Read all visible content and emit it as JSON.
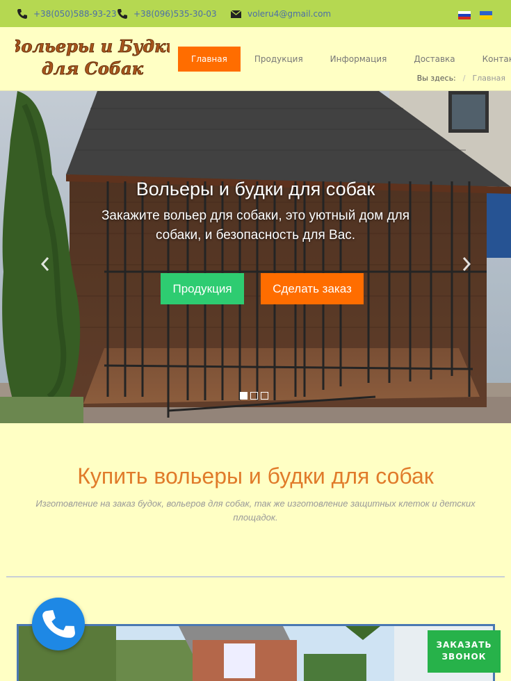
{
  "topbar": {
    "phone1": "+38(050)588-93-23",
    "phone2": "+38(096)535-30-03",
    "email": "voleru4@gmail.com",
    "phone_icon": "phone-icon",
    "email_icon": "envelope-icon",
    "flags": [
      "flag-ru-icon",
      "flag-ua-icon"
    ],
    "bg_color": "#b5d851"
  },
  "header": {
    "logo_lines": [
      "Вольеры и Будки",
      "для Собак"
    ],
    "nav": [
      "Главная",
      "Продукция",
      "Информация",
      "Доставка",
      "Контакты"
    ],
    "active_nav": "Главная",
    "breadcrumb": {
      "prefix": "Вы здесь:",
      "separator": "/",
      "current": "Главная"
    },
    "accent_color": "#ff6d00"
  },
  "hero": {
    "title": "Вольеры и будки для собак",
    "subtitle": "Закажите вольер для собаки, это уютный дом для собаки, и безопасность для Вас.",
    "btn_products": "Продукция",
    "btn_order": "Сделать заказ",
    "prev_icon": "chevron-left-icon",
    "next_icon": "chevron-right-icon",
    "slides_total": 3,
    "slide_active": 1
  },
  "section": {
    "title": "Купить вольеры и будки для собак",
    "subtitle": "Изготовление на заказ будок, вольеров для собак, так же изготовление защитных клеток и детских площадок."
  },
  "widgets": {
    "call_icon": "phone-icon",
    "callback_label": "ЗАКАЗАТЬ ЗВОНОК"
  }
}
